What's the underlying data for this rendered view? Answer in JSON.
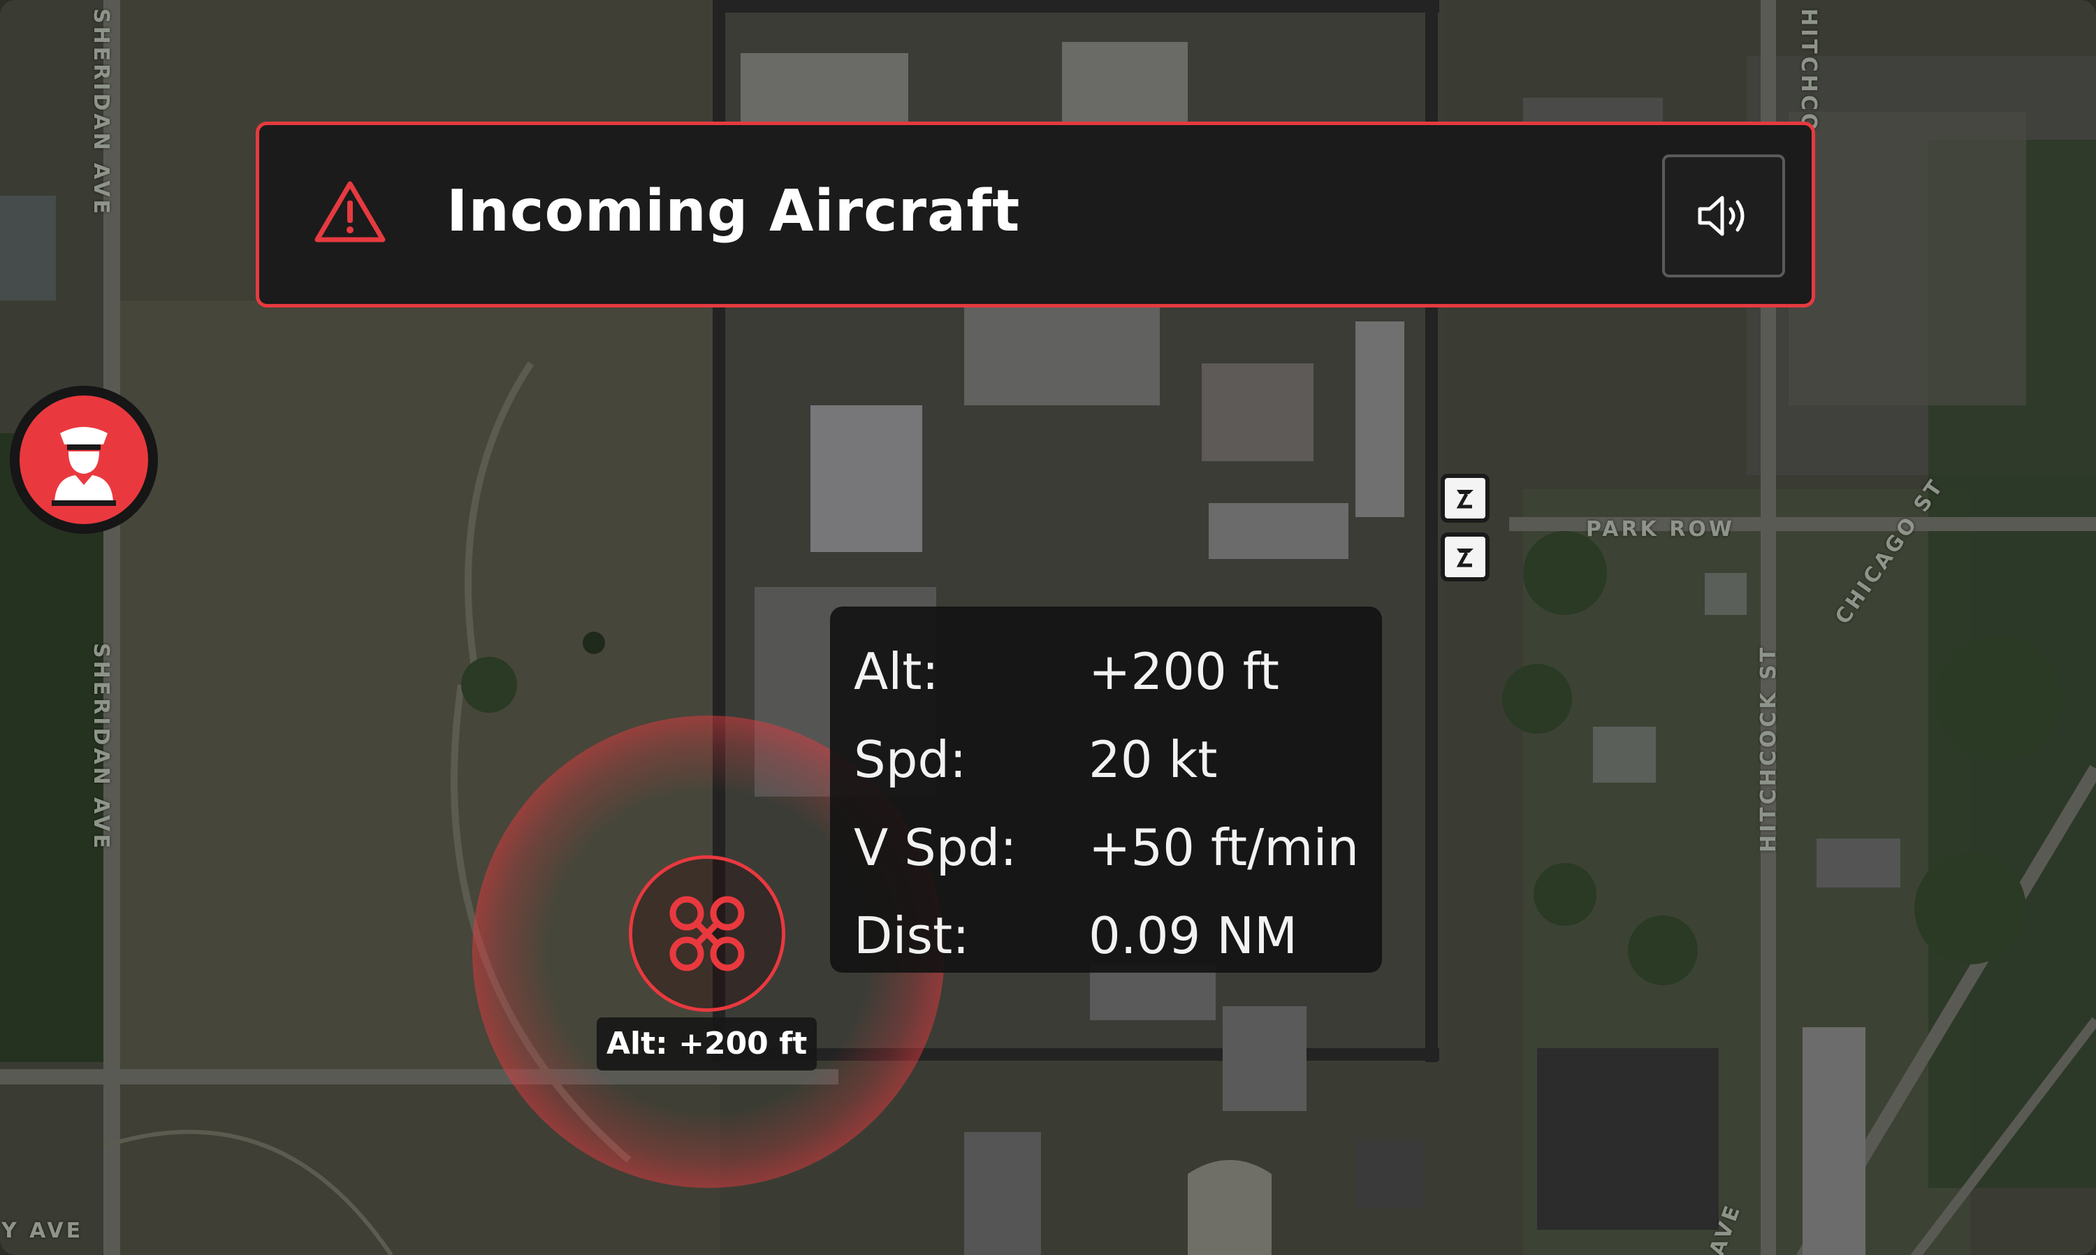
{
  "map": {
    "street_labels": {
      "sheridan_top": "SHERIDAN AVE",
      "sheridan_mid": "SHERIDAN AVE",
      "bottom_left": "Y AVE",
      "hitchcock_top": "HITCHCO",
      "park_row": "PARK ROW",
      "chicago": "CHICAGO ST",
      "hitchcock": "HITCHCOCK ST",
      "bottom_right": "AVE"
    }
  },
  "alert": {
    "title": "Incoming Aircraft",
    "icon": "warning-triangle-icon",
    "sound_icon": "speaker-volume-icon",
    "accent_color": "#e63a3f"
  },
  "officer_marker": {
    "icon": "officer-icon",
    "color": "#e9393f"
  },
  "aircraft": {
    "icon": "drone-icon",
    "alt_label": "Alt: +200 ft",
    "color": "#e9393f"
  },
  "info_card": {
    "rows": [
      {
        "key": "Alt:",
        "value": "+200 ft"
      },
      {
        "key": "Spd:",
        "value": "20 kt"
      },
      {
        "key": "V Spd:",
        "value": "+50 ft/min"
      },
      {
        "key": "Dist:",
        "value": "0.09 NM"
      }
    ]
  },
  "poi_markers": [
    {
      "icon": "tower-icon"
    },
    {
      "icon": "tower-icon"
    }
  ]
}
